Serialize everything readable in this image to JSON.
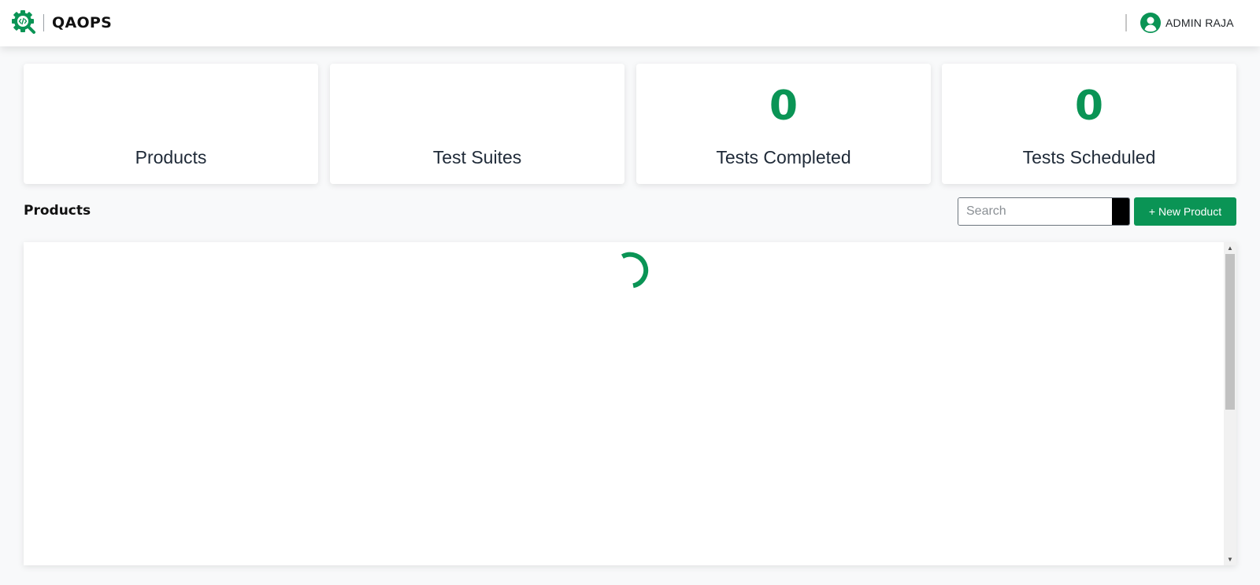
{
  "header": {
    "brand_name": "QAOPS",
    "logo_icon": "gear-code-magnifier-logo",
    "user_name": "ADMIN RAJA",
    "avatar_icon": "user-circle-icon"
  },
  "stats": [
    {
      "value": "",
      "label": "Products"
    },
    {
      "value": "",
      "label": "Test Suites"
    },
    {
      "value": "0",
      "label": "Tests Completed"
    },
    {
      "value": "0",
      "label": "Tests Scheduled"
    }
  ],
  "products": {
    "title": "Products",
    "search_placeholder": "Search",
    "search_value": "",
    "new_button_label": "+ New Product",
    "loading": true
  },
  "colors": {
    "accent": "#0a9455",
    "text": "#1f2a38",
    "background": "#f8f9fa"
  }
}
